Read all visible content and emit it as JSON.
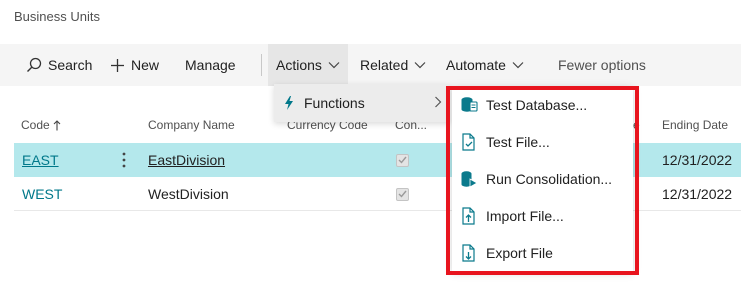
{
  "page": {
    "title": "Business Units"
  },
  "actionbar": {
    "search_label": "Search",
    "new_label": "New",
    "manage_label": "Manage",
    "actions_label": "Actions",
    "related_label": "Related",
    "automate_label": "Automate",
    "fewer_label": "Fewer options"
  },
  "grid": {
    "columns": {
      "code": "Code",
      "company_name": "Company Name",
      "currency_code": "Currency Code",
      "consolidate": "Con...",
      "ending_date": "Ending Date",
      "hidden_suffix": "e"
    },
    "rows": [
      {
        "code": "EAST",
        "company": "EastDivision",
        "ending": "12/31/2022",
        "checked": true,
        "selected": true
      },
      {
        "code": "WEST",
        "company": "WestDivision",
        "ending": "12/31/2022",
        "checked": true,
        "selected": false
      }
    ]
  },
  "functions_menu": {
    "label": "Functions"
  },
  "submenu": {
    "items": [
      {
        "label": "Test Database...",
        "icon": "test-database-icon"
      },
      {
        "label": "Test File...",
        "icon": "test-file-icon"
      },
      {
        "label": "Run Consolidation...",
        "icon": "run-consolidation-icon"
      },
      {
        "label": "Import File...",
        "icon": "import-file-icon"
      },
      {
        "label": "Export File",
        "icon": "export-file-icon"
      }
    ]
  },
  "colors": {
    "accent": "#00788a",
    "selected_row": "#b4e8ec",
    "highlight": "#e8141e"
  }
}
